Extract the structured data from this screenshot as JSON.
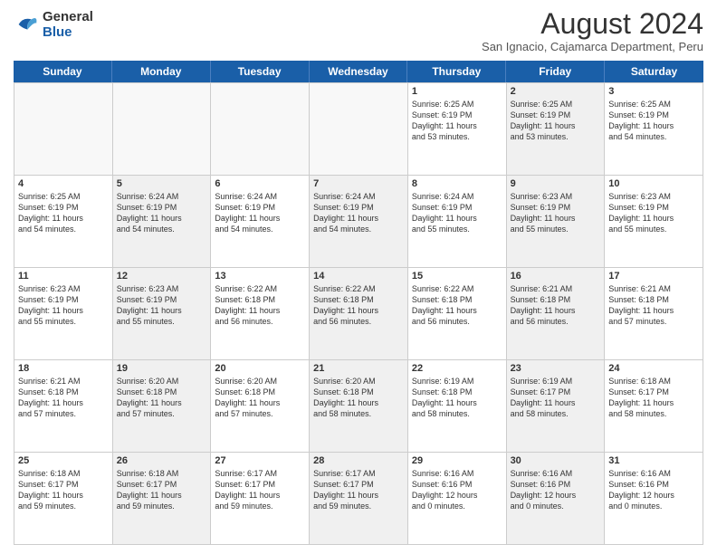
{
  "logo": {
    "line1": "General",
    "line2": "Blue"
  },
  "title": {
    "month_year": "August 2024",
    "location": "San Ignacio, Cajamarca Department, Peru"
  },
  "days_of_week": [
    "Sunday",
    "Monday",
    "Tuesday",
    "Wednesday",
    "Thursday",
    "Friday",
    "Saturday"
  ],
  "weeks": [
    [
      {
        "day": "",
        "empty": true,
        "content": ""
      },
      {
        "day": "",
        "empty": true,
        "content": ""
      },
      {
        "day": "",
        "empty": true,
        "content": ""
      },
      {
        "day": "",
        "empty": true,
        "content": ""
      },
      {
        "day": "1",
        "empty": false,
        "shaded": false,
        "content": "Sunrise: 6:25 AM\nSunset: 6:19 PM\nDaylight: 11 hours\nand 53 minutes."
      },
      {
        "day": "2",
        "empty": false,
        "shaded": true,
        "content": "Sunrise: 6:25 AM\nSunset: 6:19 PM\nDaylight: 11 hours\nand 53 minutes."
      },
      {
        "day": "3",
        "empty": false,
        "shaded": false,
        "content": "Sunrise: 6:25 AM\nSunset: 6:19 PM\nDaylight: 11 hours\nand 54 minutes."
      }
    ],
    [
      {
        "day": "4",
        "empty": false,
        "shaded": false,
        "content": "Sunrise: 6:25 AM\nSunset: 6:19 PM\nDaylight: 11 hours\nand 54 minutes."
      },
      {
        "day": "5",
        "empty": false,
        "shaded": true,
        "content": "Sunrise: 6:24 AM\nSunset: 6:19 PM\nDaylight: 11 hours\nand 54 minutes."
      },
      {
        "day": "6",
        "empty": false,
        "shaded": false,
        "content": "Sunrise: 6:24 AM\nSunset: 6:19 PM\nDaylight: 11 hours\nand 54 minutes."
      },
      {
        "day": "7",
        "empty": false,
        "shaded": true,
        "content": "Sunrise: 6:24 AM\nSunset: 6:19 PM\nDaylight: 11 hours\nand 54 minutes."
      },
      {
        "day": "8",
        "empty": false,
        "shaded": false,
        "content": "Sunrise: 6:24 AM\nSunset: 6:19 PM\nDaylight: 11 hours\nand 55 minutes."
      },
      {
        "day": "9",
        "empty": false,
        "shaded": true,
        "content": "Sunrise: 6:23 AM\nSunset: 6:19 PM\nDaylight: 11 hours\nand 55 minutes."
      },
      {
        "day": "10",
        "empty": false,
        "shaded": false,
        "content": "Sunrise: 6:23 AM\nSunset: 6:19 PM\nDaylight: 11 hours\nand 55 minutes."
      }
    ],
    [
      {
        "day": "11",
        "empty": false,
        "shaded": false,
        "content": "Sunrise: 6:23 AM\nSunset: 6:19 PM\nDaylight: 11 hours\nand 55 minutes."
      },
      {
        "day": "12",
        "empty": false,
        "shaded": true,
        "content": "Sunrise: 6:23 AM\nSunset: 6:19 PM\nDaylight: 11 hours\nand 55 minutes."
      },
      {
        "day": "13",
        "empty": false,
        "shaded": false,
        "content": "Sunrise: 6:22 AM\nSunset: 6:18 PM\nDaylight: 11 hours\nand 56 minutes."
      },
      {
        "day": "14",
        "empty": false,
        "shaded": true,
        "content": "Sunrise: 6:22 AM\nSunset: 6:18 PM\nDaylight: 11 hours\nand 56 minutes."
      },
      {
        "day": "15",
        "empty": false,
        "shaded": false,
        "content": "Sunrise: 6:22 AM\nSunset: 6:18 PM\nDaylight: 11 hours\nand 56 minutes."
      },
      {
        "day": "16",
        "empty": false,
        "shaded": true,
        "content": "Sunrise: 6:21 AM\nSunset: 6:18 PM\nDaylight: 11 hours\nand 56 minutes."
      },
      {
        "day": "17",
        "empty": false,
        "shaded": false,
        "content": "Sunrise: 6:21 AM\nSunset: 6:18 PM\nDaylight: 11 hours\nand 57 minutes."
      }
    ],
    [
      {
        "day": "18",
        "empty": false,
        "shaded": false,
        "content": "Sunrise: 6:21 AM\nSunset: 6:18 PM\nDaylight: 11 hours\nand 57 minutes."
      },
      {
        "day": "19",
        "empty": false,
        "shaded": true,
        "content": "Sunrise: 6:20 AM\nSunset: 6:18 PM\nDaylight: 11 hours\nand 57 minutes."
      },
      {
        "day": "20",
        "empty": false,
        "shaded": false,
        "content": "Sunrise: 6:20 AM\nSunset: 6:18 PM\nDaylight: 11 hours\nand 57 minutes."
      },
      {
        "day": "21",
        "empty": false,
        "shaded": true,
        "content": "Sunrise: 6:20 AM\nSunset: 6:18 PM\nDaylight: 11 hours\nand 58 minutes."
      },
      {
        "day": "22",
        "empty": false,
        "shaded": false,
        "content": "Sunrise: 6:19 AM\nSunset: 6:18 PM\nDaylight: 11 hours\nand 58 minutes."
      },
      {
        "day": "23",
        "empty": false,
        "shaded": true,
        "content": "Sunrise: 6:19 AM\nSunset: 6:17 PM\nDaylight: 11 hours\nand 58 minutes."
      },
      {
        "day": "24",
        "empty": false,
        "shaded": false,
        "content": "Sunrise: 6:18 AM\nSunset: 6:17 PM\nDaylight: 11 hours\nand 58 minutes."
      }
    ],
    [
      {
        "day": "25",
        "empty": false,
        "shaded": false,
        "content": "Sunrise: 6:18 AM\nSunset: 6:17 PM\nDaylight: 11 hours\nand 59 minutes."
      },
      {
        "day": "26",
        "empty": false,
        "shaded": true,
        "content": "Sunrise: 6:18 AM\nSunset: 6:17 PM\nDaylight: 11 hours\nand 59 minutes."
      },
      {
        "day": "27",
        "empty": false,
        "shaded": false,
        "content": "Sunrise: 6:17 AM\nSunset: 6:17 PM\nDaylight: 11 hours\nand 59 minutes."
      },
      {
        "day": "28",
        "empty": false,
        "shaded": true,
        "content": "Sunrise: 6:17 AM\nSunset: 6:17 PM\nDaylight: 11 hours\nand 59 minutes."
      },
      {
        "day": "29",
        "empty": false,
        "shaded": false,
        "content": "Sunrise: 6:16 AM\nSunset: 6:16 PM\nDaylight: 12 hours\nand 0 minutes."
      },
      {
        "day": "30",
        "empty": false,
        "shaded": true,
        "content": "Sunrise: 6:16 AM\nSunset: 6:16 PM\nDaylight: 12 hours\nand 0 minutes."
      },
      {
        "day": "31",
        "empty": false,
        "shaded": false,
        "content": "Sunrise: 6:16 AM\nSunset: 6:16 PM\nDaylight: 12 hours\nand 0 minutes."
      }
    ]
  ]
}
